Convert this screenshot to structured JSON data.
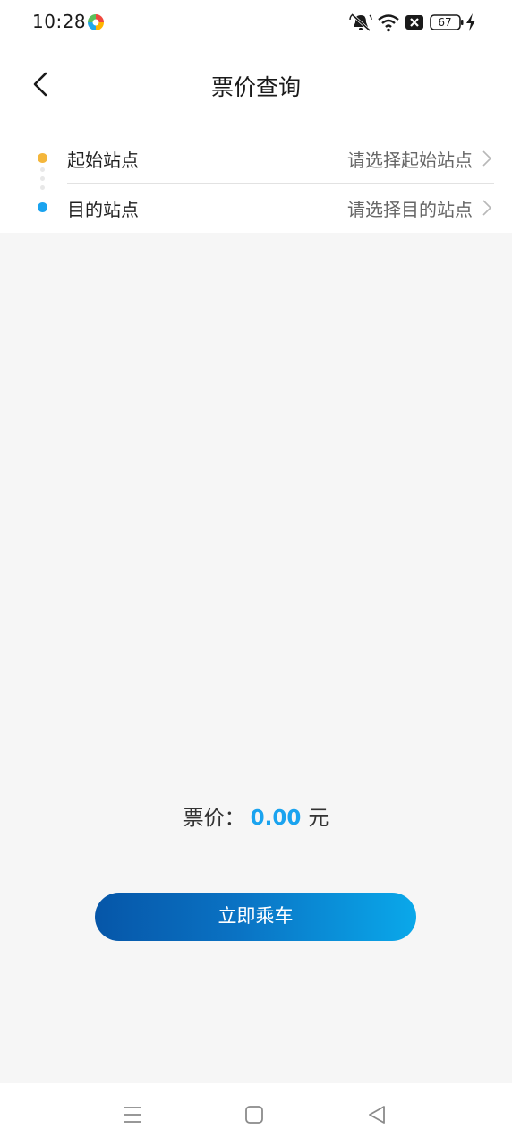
{
  "status_bar": {
    "time": "10:28",
    "battery": "67",
    "icons": [
      "app-notification-icon",
      "mute-icon",
      "wifi-icon",
      "sim-x-icon",
      "battery-icon",
      "charging-icon"
    ]
  },
  "header": {
    "title": "票价查询",
    "back_icon": "chevron-left-icon"
  },
  "stations": {
    "start": {
      "label": "起始站点",
      "placeholder": "请选择起始站点"
    },
    "end": {
      "label": "目的站点",
      "placeholder": "请选择目的站点"
    }
  },
  "fare": {
    "label": "票价：",
    "value": "0.00",
    "unit": "元"
  },
  "board_button": {
    "label": "立即乘车"
  },
  "colors": {
    "accent": "#1aa3ef",
    "start_dot": "#f4b63b",
    "end_dot": "#1aa3ef",
    "button_gradient_start": "#0656a8",
    "button_gradient_end": "#0aa8ea",
    "background": "#f6f6f6"
  },
  "nav_bar": {
    "icons": [
      "menu-icon",
      "home-icon",
      "back-triangle-icon"
    ]
  }
}
